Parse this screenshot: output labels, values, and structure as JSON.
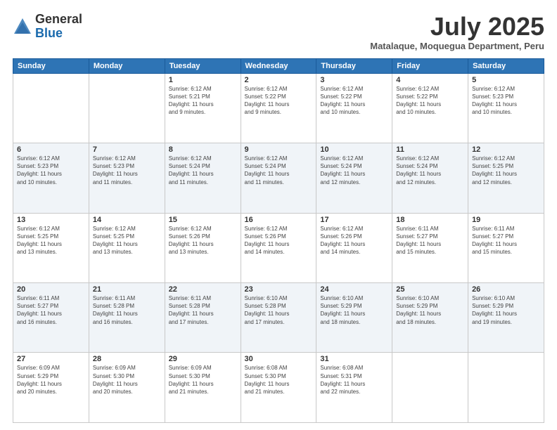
{
  "logo": {
    "general": "General",
    "blue": "Blue"
  },
  "header": {
    "month": "July 2025",
    "location": "Matalaque, Moquegua Department, Peru"
  },
  "weekdays": [
    "Sunday",
    "Monday",
    "Tuesday",
    "Wednesday",
    "Thursday",
    "Friday",
    "Saturday"
  ],
  "weeks": [
    [
      {
        "day": "",
        "info": ""
      },
      {
        "day": "",
        "info": ""
      },
      {
        "day": "1",
        "info": "Sunrise: 6:12 AM\nSunset: 5:21 PM\nDaylight: 11 hours\nand 9 minutes."
      },
      {
        "day": "2",
        "info": "Sunrise: 6:12 AM\nSunset: 5:22 PM\nDaylight: 11 hours\nand 9 minutes."
      },
      {
        "day": "3",
        "info": "Sunrise: 6:12 AM\nSunset: 5:22 PM\nDaylight: 11 hours\nand 10 minutes."
      },
      {
        "day": "4",
        "info": "Sunrise: 6:12 AM\nSunset: 5:22 PM\nDaylight: 11 hours\nand 10 minutes."
      },
      {
        "day": "5",
        "info": "Sunrise: 6:12 AM\nSunset: 5:23 PM\nDaylight: 11 hours\nand 10 minutes."
      }
    ],
    [
      {
        "day": "6",
        "info": "Sunrise: 6:12 AM\nSunset: 5:23 PM\nDaylight: 11 hours\nand 10 minutes."
      },
      {
        "day": "7",
        "info": "Sunrise: 6:12 AM\nSunset: 5:23 PM\nDaylight: 11 hours\nand 11 minutes."
      },
      {
        "day": "8",
        "info": "Sunrise: 6:12 AM\nSunset: 5:24 PM\nDaylight: 11 hours\nand 11 minutes."
      },
      {
        "day": "9",
        "info": "Sunrise: 6:12 AM\nSunset: 5:24 PM\nDaylight: 11 hours\nand 11 minutes."
      },
      {
        "day": "10",
        "info": "Sunrise: 6:12 AM\nSunset: 5:24 PM\nDaylight: 11 hours\nand 12 minutes."
      },
      {
        "day": "11",
        "info": "Sunrise: 6:12 AM\nSunset: 5:24 PM\nDaylight: 11 hours\nand 12 minutes."
      },
      {
        "day": "12",
        "info": "Sunrise: 6:12 AM\nSunset: 5:25 PM\nDaylight: 11 hours\nand 12 minutes."
      }
    ],
    [
      {
        "day": "13",
        "info": "Sunrise: 6:12 AM\nSunset: 5:25 PM\nDaylight: 11 hours\nand 13 minutes."
      },
      {
        "day": "14",
        "info": "Sunrise: 6:12 AM\nSunset: 5:25 PM\nDaylight: 11 hours\nand 13 minutes."
      },
      {
        "day": "15",
        "info": "Sunrise: 6:12 AM\nSunset: 5:26 PM\nDaylight: 11 hours\nand 13 minutes."
      },
      {
        "day": "16",
        "info": "Sunrise: 6:12 AM\nSunset: 5:26 PM\nDaylight: 11 hours\nand 14 minutes."
      },
      {
        "day": "17",
        "info": "Sunrise: 6:12 AM\nSunset: 5:26 PM\nDaylight: 11 hours\nand 14 minutes."
      },
      {
        "day": "18",
        "info": "Sunrise: 6:11 AM\nSunset: 5:27 PM\nDaylight: 11 hours\nand 15 minutes."
      },
      {
        "day": "19",
        "info": "Sunrise: 6:11 AM\nSunset: 5:27 PM\nDaylight: 11 hours\nand 15 minutes."
      }
    ],
    [
      {
        "day": "20",
        "info": "Sunrise: 6:11 AM\nSunset: 5:27 PM\nDaylight: 11 hours\nand 16 minutes."
      },
      {
        "day": "21",
        "info": "Sunrise: 6:11 AM\nSunset: 5:28 PM\nDaylight: 11 hours\nand 16 minutes."
      },
      {
        "day": "22",
        "info": "Sunrise: 6:11 AM\nSunset: 5:28 PM\nDaylight: 11 hours\nand 17 minutes."
      },
      {
        "day": "23",
        "info": "Sunrise: 6:10 AM\nSunset: 5:28 PM\nDaylight: 11 hours\nand 17 minutes."
      },
      {
        "day": "24",
        "info": "Sunrise: 6:10 AM\nSunset: 5:29 PM\nDaylight: 11 hours\nand 18 minutes."
      },
      {
        "day": "25",
        "info": "Sunrise: 6:10 AM\nSunset: 5:29 PM\nDaylight: 11 hours\nand 18 minutes."
      },
      {
        "day": "26",
        "info": "Sunrise: 6:10 AM\nSunset: 5:29 PM\nDaylight: 11 hours\nand 19 minutes."
      }
    ],
    [
      {
        "day": "27",
        "info": "Sunrise: 6:09 AM\nSunset: 5:29 PM\nDaylight: 11 hours\nand 20 minutes."
      },
      {
        "day": "28",
        "info": "Sunrise: 6:09 AM\nSunset: 5:30 PM\nDaylight: 11 hours\nand 20 minutes."
      },
      {
        "day": "29",
        "info": "Sunrise: 6:09 AM\nSunset: 5:30 PM\nDaylight: 11 hours\nand 21 minutes."
      },
      {
        "day": "30",
        "info": "Sunrise: 6:08 AM\nSunset: 5:30 PM\nDaylight: 11 hours\nand 21 minutes."
      },
      {
        "day": "31",
        "info": "Sunrise: 6:08 AM\nSunset: 5:31 PM\nDaylight: 11 hours\nand 22 minutes."
      },
      {
        "day": "",
        "info": ""
      },
      {
        "day": "",
        "info": ""
      }
    ]
  ]
}
